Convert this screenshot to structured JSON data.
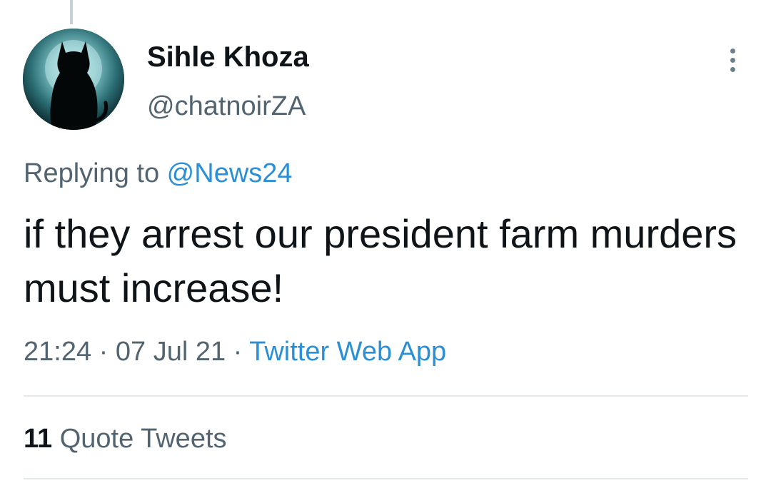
{
  "tweet": {
    "author": {
      "display_name": "Sihle Khoza",
      "handle": "@chatnoirZA"
    },
    "replying_to_prefix": "Replying to ",
    "replying_to_handle": "@News24",
    "text": "if they arrest our president farm murders must increase!",
    "time": "21:24",
    "separator": " · ",
    "date": "07 Jul 21",
    "source": "Twitter Web App",
    "stats": {
      "quote_tweets_count": "11",
      "quote_tweets_label": "Quote Tweets"
    }
  },
  "icons": {
    "more": "more-options-icon",
    "avatar": "black-cat-moon-avatar"
  },
  "colors": {
    "text": "#0f1419",
    "secondary": "#536471",
    "link": "#2a8fd6",
    "divider": "#e3e8eb"
  }
}
